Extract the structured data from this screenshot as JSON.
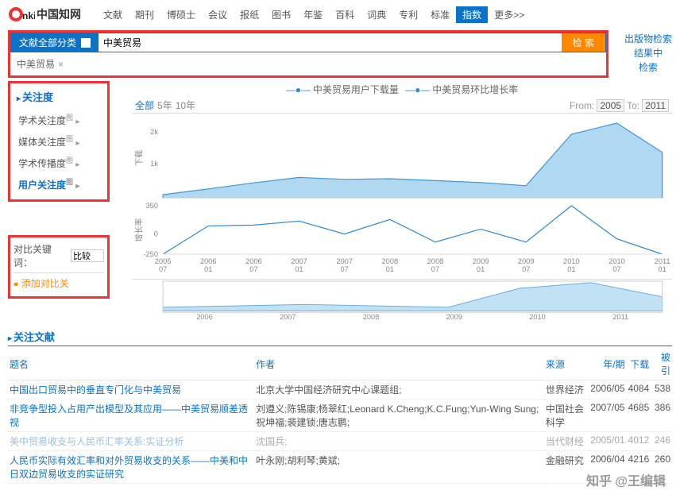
{
  "logo": {
    "text": "中国知网"
  },
  "nav": [
    "文献",
    "期刊",
    "博硕士",
    "会议",
    "报纸",
    "图书",
    "年鉴",
    "百科",
    "词典",
    "专利",
    "标准",
    "指数",
    "更多>>"
  ],
  "nav_active_index": 11,
  "search": {
    "dropdown": "文献全部分类",
    "query": "中美贸易",
    "btn": "检 索",
    "tag": "中美贸易"
  },
  "right_links": [
    "出版物检索",
    "结果中",
    "检索"
  ],
  "sidebar": {
    "title": "关注度",
    "items": [
      {
        "label": "学术关注度",
        "sup": "图",
        "active": false
      },
      {
        "label": "媒体关注度",
        "sup": "图",
        "active": false
      },
      {
        "label": "学术传播度",
        "sup": "图",
        "active": false
      },
      {
        "label": "用户关注度",
        "sup": "图",
        "active": true
      }
    ]
  },
  "compare": {
    "label": "对比关键词：",
    "btn": "比较",
    "add": "添加对比关"
  },
  "chart": {
    "legend1": "中美贸易用户下载量",
    "legend2": "中美贸易环比增长率",
    "tabs": [
      "全部",
      "5年",
      "10年"
    ],
    "from_label": "From:",
    "from": "2005",
    "to_label": "To:",
    "to": "2011",
    "y1_title": "下载",
    "y2_title": "增长率"
  },
  "chart_data": {
    "type": "line",
    "x": [
      "2005/07",
      "2006/01",
      "2006/07",
      "2007/01",
      "2007/07",
      "2008/01",
      "2008/07",
      "2009/01",
      "2009/07",
      "2010/01",
      "2010/07",
      "2011/01"
    ],
    "series": [
      {
        "name": "中美贸易用户下载量",
        "values": [
          100,
          280,
          470,
          640,
          580,
          600,
          540,
          480,
          380,
          2000,
          2350,
          1430
        ]
      },
      {
        "name": "中美贸易环比增长率",
        "values": [
          -250,
          100,
          110,
          160,
          0,
          180,
          -100,
          60,
          -100,
          350,
          -60,
          -250
        ]
      }
    ],
    "y1lim": [
      0,
      2500
    ],
    "y2lim": [
      -250,
      350
    ],
    "mini_x": [
      "2006",
      "2007",
      "2008",
      "2009",
      "2010",
      "2011"
    ],
    "mini_values": [
      5,
      7,
      9,
      7,
      5,
      32,
      40,
      20
    ]
  },
  "lit": {
    "header": "关注文献",
    "cols": [
      "题名",
      "作者",
      "来源",
      "年/期",
      "下载",
      "被引"
    ],
    "rows": [
      {
        "title": "中国出口贸易中的垂直专门化与中美贸易",
        "author": "北京大学中国经济研究中心课题组;",
        "source": "世界经济",
        "year": "2006/05",
        "dl": "4084",
        "cite": "538"
      },
      {
        "title": "非竞争型投入占用产出模型及其应用——中美贸易顺差透视",
        "author": "刘遵义;陈锡康;杨翠红;Leonard K.Cheng;K.C.Fung;Yun-Wing Sung;祝坤福;裴建锁;唐志鹏;",
        "source": "中国社会科学",
        "year": "2007/05",
        "dl": "4685",
        "cite": "386"
      },
      {
        "title": "美中贸易收支与人民币汇率关系:实证分析",
        "author": "沈国兵;",
        "source": "当代财经",
        "year": "2005/01",
        "dl": "4012",
        "cite": "246",
        "faded": true
      },
      {
        "title": "人民币实际有效汇率和对外贸易收支的关系——中美和中日双边贸易收支的实证研究",
        "author": "叶永刚;胡利琴;黄斌;",
        "source": "金融研究",
        "year": "2006/04",
        "dl": "4216",
        "cite": "260"
      }
    ]
  },
  "watermark": "知乎 @王编辑"
}
